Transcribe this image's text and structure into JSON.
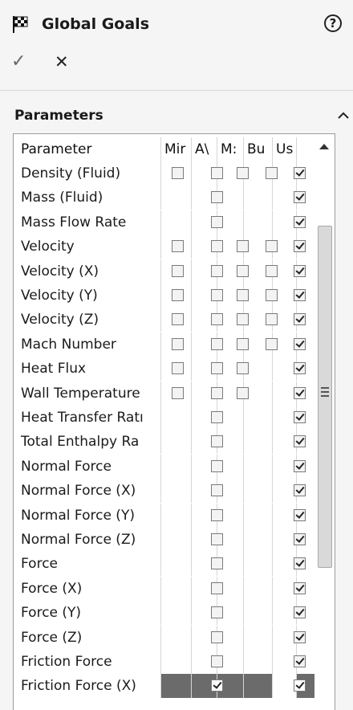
{
  "header": {
    "title": "Global Goals",
    "help": "?"
  },
  "actions": {
    "ok": "✓",
    "cancel": "✕"
  },
  "section": {
    "title": "Parameters"
  },
  "table": {
    "columns": [
      "Parameter",
      "Mir",
      "A\\",
      "M:",
      "Bu",
      "Us"
    ],
    "rows": [
      {
        "name": "Density (Fluid)",
        "min": false,
        "avg": false,
        "max": false,
        "bulk": false,
        "use": true
      },
      {
        "name": "Mass (Fluid)",
        "avg": false,
        "use": true
      },
      {
        "name": "Mass Flow Rate",
        "avg": false,
        "use": true
      },
      {
        "name": "Velocity",
        "min": false,
        "avg": false,
        "max": false,
        "bulk": false,
        "use": true
      },
      {
        "name": "Velocity (X)",
        "min": false,
        "avg": false,
        "max": false,
        "bulk": false,
        "use": true
      },
      {
        "name": "Velocity (Y)",
        "min": false,
        "avg": false,
        "max": false,
        "bulk": false,
        "use": true
      },
      {
        "name": "Velocity (Z)",
        "min": false,
        "avg": false,
        "max": false,
        "bulk": false,
        "use": true
      },
      {
        "name": "Mach Number",
        "min": false,
        "avg": false,
        "max": false,
        "bulk": false,
        "use": true
      },
      {
        "name": "Heat Flux",
        "min": false,
        "avg": false,
        "max": false,
        "use": true
      },
      {
        "name": "Wall Temperature",
        "min": false,
        "avg": false,
        "max": false,
        "use": true
      },
      {
        "name": "Heat Transfer Ratı",
        "avg": false,
        "use": true
      },
      {
        "name": "Total Enthalpy Ra",
        "avg": false,
        "use": true
      },
      {
        "name": "Normal Force",
        "avg": false,
        "use": true
      },
      {
        "name": "Normal Force (X)",
        "avg": false,
        "use": true
      },
      {
        "name": "Normal Force (Y)",
        "avg": false,
        "use": true
      },
      {
        "name": "Normal Force (Z)",
        "avg": false,
        "use": true
      },
      {
        "name": "Force",
        "avg": false,
        "use": true
      },
      {
        "name": "Force (X)",
        "avg": false,
        "use": true
      },
      {
        "name": "Force (Y)",
        "avg": false,
        "use": true
      },
      {
        "name": "Force (Z)",
        "avg": false,
        "use": true
      },
      {
        "name": "Friction Force",
        "avg": false,
        "use": true
      },
      {
        "name": "Friction Force (X)",
        "avg": true,
        "use": true,
        "selected": true
      }
    ]
  },
  "colors": {
    "selected_row": "#6b6b6b"
  }
}
